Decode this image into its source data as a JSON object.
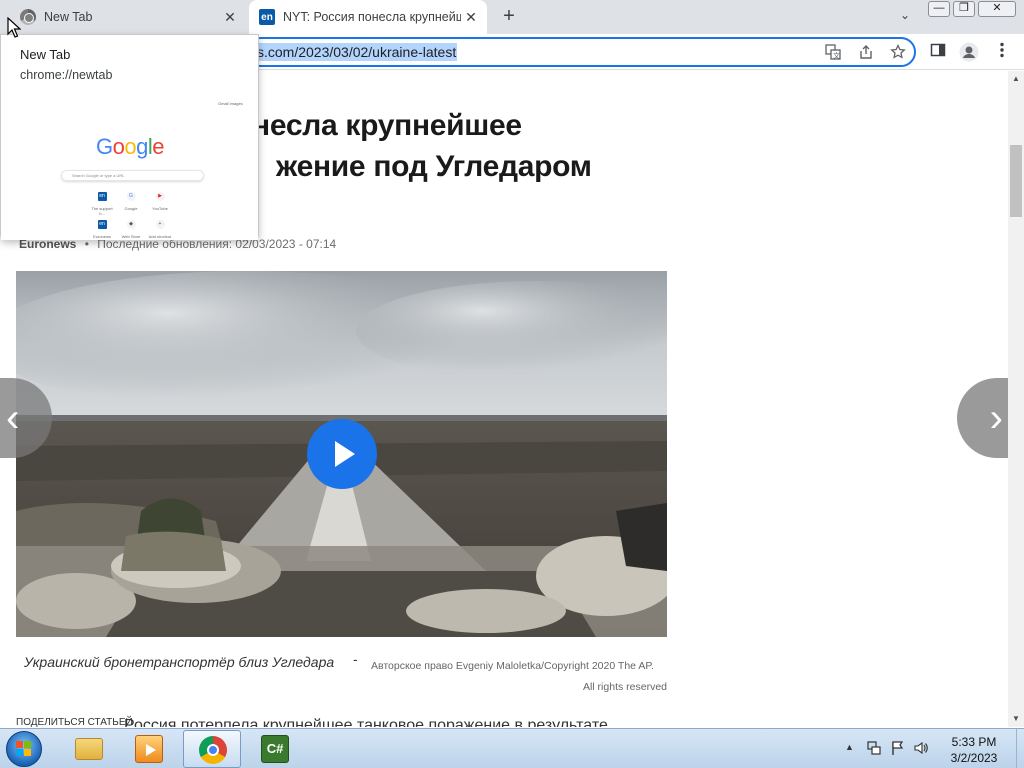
{
  "browser": {
    "tabs": [
      {
        "title": "New Tab",
        "favicon": "chrome-icon"
      },
      {
        "title": "NYT: Россия понесла крупнейш",
        "favicon": "euronews-icon",
        "favicon_text": "en"
      }
    ],
    "new_tab_symbol": "+",
    "close_symbol": "✕",
    "tab_search_symbol": "⌄",
    "window_controls": {
      "minimize": "—",
      "restore": "❐",
      "close": "✕"
    },
    "address": {
      "visible_url": "s.com/2023/03/02/ukraine-latest"
    }
  },
  "hover_card": {
    "title": "New Tab",
    "url": "chrome://newtab",
    "preview": {
      "logo_text": "Google",
      "search_placeholder": "Search Google or type a URL",
      "top_links": "Gmail  Images",
      "shortcuts": [
        {
          "label": "The support h...",
          "glyph": "en"
        },
        {
          "label": "Google",
          "glyph": "G"
        },
        {
          "label": "YouTube",
          "glyph": "▶"
        },
        {
          "label": "Euronews",
          "glyph": "en"
        },
        {
          "label": "Web Store",
          "glyph": "◆"
        },
        {
          "label": "Add shortcut",
          "glyph": "+"
        }
      ]
    }
  },
  "article": {
    "headline_line1": "онесла крупнейшее",
    "headline_line2": "жение под Угледаром",
    "source": "Euronews",
    "separator": "•",
    "updated": "Последние обновления: 02/03/2023 - 07:14",
    "caption": "Украинский бронетранспортёр близ Угледара",
    "caption_dash": "-",
    "copyright_line1": "Авторское право  Evgeniy Maloletka/Copyright 2020 The AP.",
    "copyright_line2": "All rights reserved",
    "share_label": "ПОДЕЛИТЬСЯ СТАТЬЕЙ",
    "lead_text": "Россия потерпела крупнейшее танковое поражение в результате"
  },
  "carousel": {
    "prev": "‹",
    "next": "›"
  },
  "taskbar": {
    "apps": [
      {
        "name": "file-explorer"
      },
      {
        "name": "media-player"
      },
      {
        "name": "google-chrome",
        "active": true
      },
      {
        "name": "csharp-editor",
        "label": "C#"
      }
    ],
    "time": "5:33 PM",
    "date": "3/2/2023"
  },
  "colors": {
    "accent_blue": "#1a73e8",
    "tabstrip": "#dee1e6",
    "euronews_blue": "#0a5aa8"
  }
}
